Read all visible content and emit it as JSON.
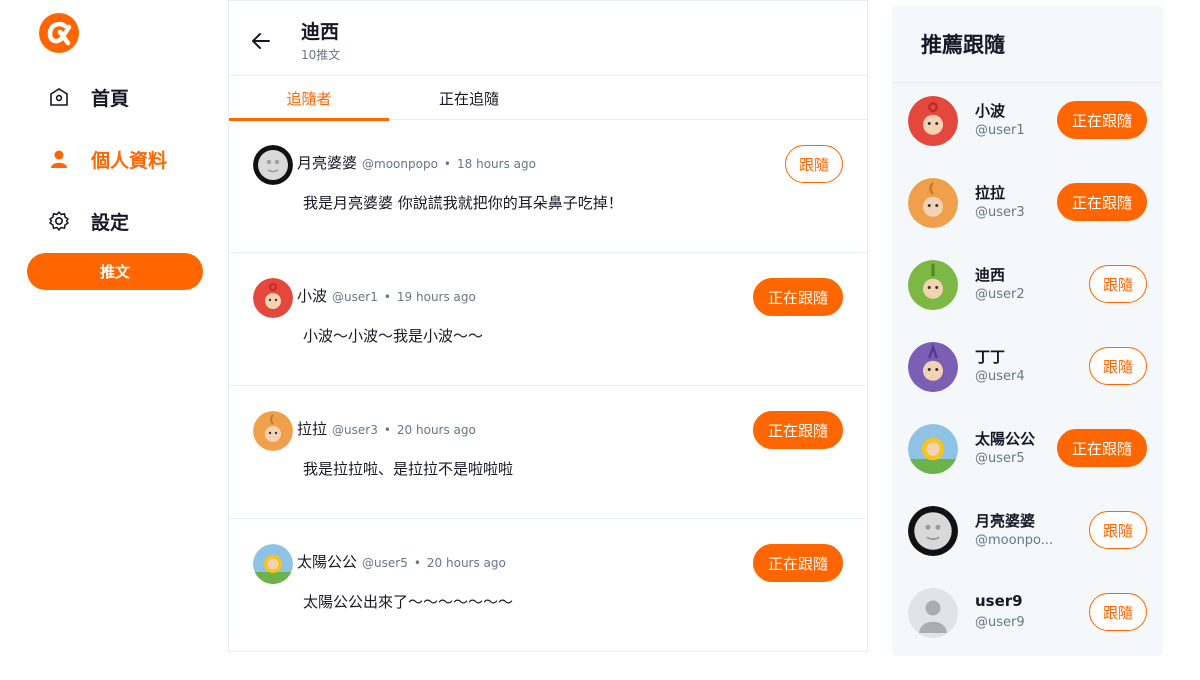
{
  "nav": {
    "items": [
      {
        "label": "首頁",
        "icon": "home-icon"
      },
      {
        "label": "個人資料",
        "icon": "user-icon"
      },
      {
        "label": "設定",
        "icon": "gear-icon"
      }
    ],
    "tweet_button": "推文"
  },
  "header": {
    "name": "迪西",
    "tweet_count": "10推文"
  },
  "tabs": [
    "追隨者",
    "正在追隨"
  ],
  "followers": [
    {
      "name": "月亮婆婆",
      "account": "@moonpopo",
      "time": "18 hours ago",
      "text": "我是月亮婆婆 你說謊我就把你的耳朵鼻子吃掉！",
      "button": "跟隨"
    },
    {
      "name": "小波",
      "account": "@user1",
      "time": "19 hours ago",
      "text": "小波～小波～我是小波～～",
      "button": "正在跟隨"
    },
    {
      "name": "拉拉",
      "account": "@user3",
      "time": "20 hours ago",
      "text": "我是拉拉啦、是拉拉不是啦啦啦",
      "button": "正在跟隨"
    },
    {
      "name": "太陽公公",
      "account": "@user5",
      "time": "20 hours ago",
      "text": "太陽公公出來了～～～～～～～",
      "button": "正在跟隨"
    }
  ],
  "separator": "•",
  "suggest": {
    "title": "推薦跟隨",
    "users": [
      {
        "name": "小波",
        "account": "@user1",
        "button": "正在跟隨"
      },
      {
        "name": "拉拉",
        "account": "@user3",
        "button": "正在跟隨"
      },
      {
        "name": "迪西",
        "account": "@user2",
        "button": "跟隨"
      },
      {
        "name": "丁丁",
        "account": "@user4",
        "button": "跟隨"
      },
      {
        "name": "太陽公公",
        "account": "@user5",
        "button": "正在跟隨"
      },
      {
        "name": "月亮婆婆",
        "account": "@moonpo...",
        "button": "跟隨"
      },
      {
        "name": "user9",
        "account": "@user9",
        "button": "跟隨"
      }
    ]
  },
  "colors": {
    "accent": "#FF6600",
    "po": "#E4473C",
    "laalaa": "#F0A04B",
    "dipsy": "#7DB845",
    "tinkywinky": "#7B5FB5"
  }
}
